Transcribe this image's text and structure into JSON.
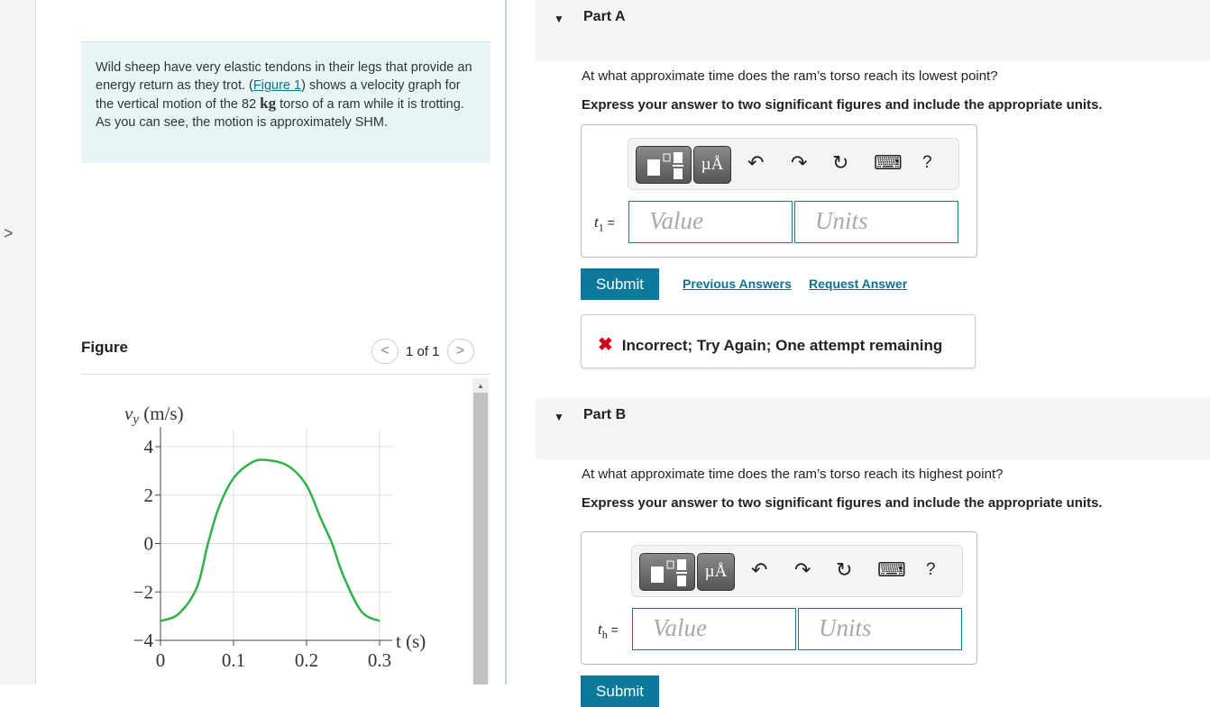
{
  "nav": {
    "expand_icon": "chevron-right"
  },
  "intro": {
    "text_before": "Wild sheep have very elastic tendons in their legs that provide an energy return as they trot. (",
    "link": "Figure 1",
    "text_mid": ") shows a velocity graph for the vertical motion of the 82 ",
    "unit": "kg",
    "text_after": " torso of a ram while it is trotting. As you can see, the motion is approximately SHM."
  },
  "figure": {
    "title": "Figure",
    "pager": "1 of 1",
    "prev": "<",
    "next": ">"
  },
  "chart_data": {
    "type": "line",
    "ylabel": "v_y (m/s)",
    "ylabel_main": "v",
    "ylabel_sub": "y",
    "ylabel_unit": " (m/s)",
    "xlabel": "t (s)",
    "xlim": [
      0,
      0.3
    ],
    "ylim": [
      -4,
      4
    ],
    "xticks": [
      "0",
      "0.1",
      "0.2",
      "0.3"
    ],
    "yticks": [
      "4",
      "2",
      "0",
      "−2",
      "−4"
    ],
    "grid": true,
    "color": "#2db34a",
    "x": [
      0,
      0.025,
      0.05,
      0.065,
      0.08,
      0.1,
      0.125,
      0.145,
      0.175,
      0.2,
      0.22,
      0.235,
      0.25,
      0.275,
      0.3
    ],
    "y": [
      -3.2,
      -2.9,
      -1.8,
      0,
      1.5,
      2.7,
      3.35,
      3.45,
      3.2,
      2.4,
      1.0,
      0,
      -1.3,
      -2.8,
      -3.2
    ]
  },
  "parts": [
    {
      "label": "Part A",
      "question": "At what approximate time does the ram’s torso reach its lowest point?",
      "instruction": "Express your answer to two significant figures and include the appropriate units.",
      "var": "t",
      "sub": "1",
      "eq": " =",
      "value_placeholder": "Value",
      "units_placeholder": "Units",
      "submit": "Submit",
      "prev_answers": "Previous Answers",
      "request_answer": "Request Answer",
      "feedback": "Incorrect; Try Again; One attempt remaining"
    },
    {
      "label": "Part B",
      "question": "At what approximate time does the ram’s torso reach its highest point?",
      "instruction": "Express your answer to two significant figures and include the appropriate units.",
      "var": "t",
      "sub": "h",
      "eq": " =",
      "value_placeholder": "Value",
      "units_placeholder": "Units",
      "submit": "Submit"
    }
  ],
  "toolbar": {
    "units_btn": "µÅ",
    "undo": "↶",
    "redo": "↷",
    "reset": "↻",
    "keyboard": "⌨",
    "help": "?"
  }
}
